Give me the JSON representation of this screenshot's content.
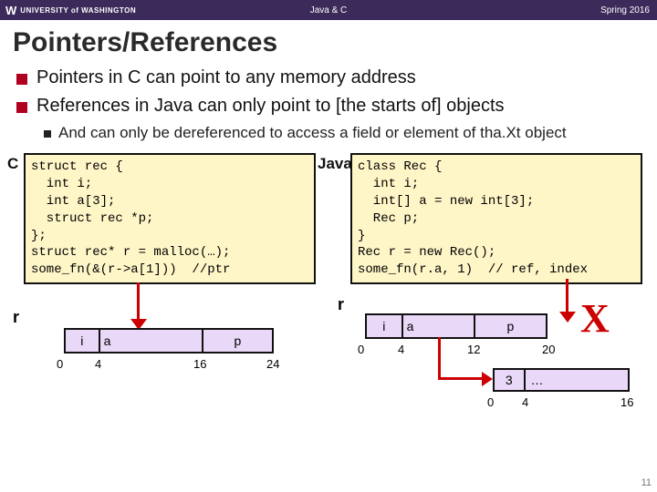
{
  "header": {
    "logo_w": "W",
    "logo_text": "UNIVERSITY of WASHINGTON",
    "center": "Java & C",
    "right": "Spring 2016"
  },
  "title": "Pointers/References",
  "bullets": {
    "b1": "Pointers in C can point to any memory address",
    "b2": "References in Java can only point to [the starts of] objects",
    "b2sub": "And can only be dereferenced to access a field or element of tha.Xt object"
  },
  "labels": {
    "c": "C",
    "java": "Java",
    "r_left": "r",
    "r_right": "r"
  },
  "code": {
    "c": "struct rec {\n  int i;\n  int a[3];\n  struct rec *p;\n};\nstruct rec* r = malloc(…);\nsome_fn(&(r->a[1]))  //ptr",
    "java": "class Rec {\n  int i;\n  int[] a = new int[3];\n  Rec p;\n}\nRec r = new Rec();\nsome_fn(r.a, 1)  // ref, index"
  },
  "mem_c": {
    "fields": {
      "i": "i",
      "a": "a",
      "p": "p"
    },
    "ticks": [
      "0",
      "4",
      "16",
      "24"
    ]
  },
  "mem_java": {
    "fields": {
      "i": "i",
      "a": "a",
      "p": "p"
    },
    "ticks": [
      "0",
      "4",
      "12",
      "20"
    ],
    "arr": {
      "len": "3",
      "dots": "…"
    },
    "arr_ticks": [
      "0",
      "4",
      "16"
    ]
  },
  "bigX": "X",
  "page": "11"
}
